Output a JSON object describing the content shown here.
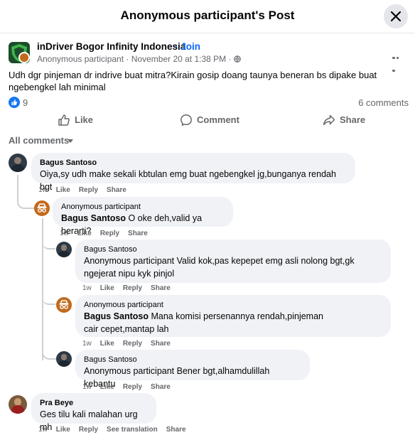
{
  "dialog": {
    "title": "Anonymous participant's Post"
  },
  "post": {
    "group_name": "inDriver Bogor Infinity Indonesia",
    "join_label": "· Join",
    "author": "Anonymous participant",
    "time": "November 20 at 1:38 PM",
    "text": "Udh dgr pinjeman dr indrive buat mitra?Kirain gosip doang taunya beneran bs dipake buat ngebengkel lah minimal",
    "reactions": "9",
    "comments_count": "6 comments",
    "actions": {
      "like": "Like",
      "comment": "Comment",
      "share": "Share"
    }
  },
  "sort_label": "All comments",
  "comment_actions": {
    "like": "Like",
    "reply": "Reply",
    "share": "Share",
    "translate": "See translation"
  },
  "comments": [
    {
      "author": "Bagus Santoso",
      "text": "Oiya,sy udh make sekali kbtulan emg buat ngebengkel jg,bunganya rendah bgt",
      "time": "1w"
    },
    {
      "author": "Anonymous participant",
      "mention": "Bagus Santoso",
      "text": "O oke deh,valid ya berarti?",
      "time": "1w"
    },
    {
      "author": "Bagus Santoso",
      "mention": "Anonymous participant",
      "text": "Valid kok,pas kepepet emg asli nolong bgt,gk ngejerat nipu kyk pinjol",
      "time": "1w"
    },
    {
      "author": "Anonymous participant",
      "mention": "Bagus Santoso",
      "text": "Mana komisi persenannya rendah,pinjeman cair cepet,mantap lah",
      "time": "1w"
    },
    {
      "author": "Bagus Santoso",
      "mention": "Anonymous participant",
      "text": "Bener bgt,alhamdulillah kebantu",
      "time": "1w"
    },
    {
      "author": "Pra Beye",
      "text": "Ges tilu kali malahan urg mh",
      "time": "1w"
    }
  ]
}
